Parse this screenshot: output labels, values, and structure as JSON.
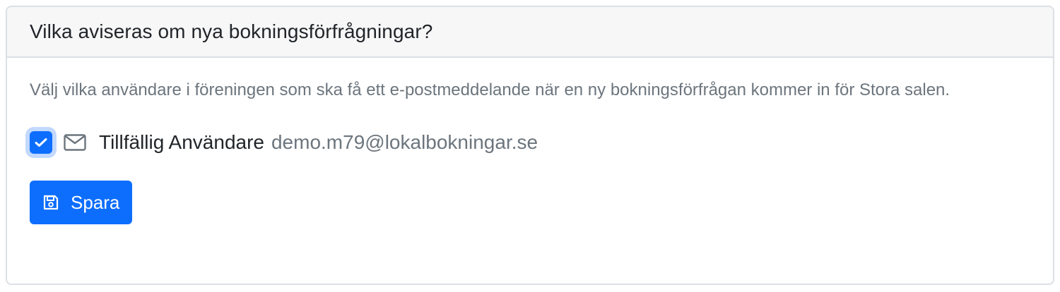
{
  "card": {
    "title": "Vilka aviseras om nya bokningsförfrågningar?",
    "description": "Välj vilka användare i föreningen som ska få ett e-postmeddelande när en ny bokningsförfrågan kommer in för Stora salen."
  },
  "users": [
    {
      "name": "Tillfällig Användare",
      "email": "demo.m79@lokalbokningar.se",
      "checked": true,
      "icon": "envelope-icon"
    }
  ],
  "actions": {
    "save_label": "Spara",
    "save_icon": "floppy-disk-icon"
  },
  "colors": {
    "primary": "#0d6efd",
    "muted_text": "#6c757d",
    "header_bg": "#f7f7f8",
    "border": "#dcdfe3"
  }
}
